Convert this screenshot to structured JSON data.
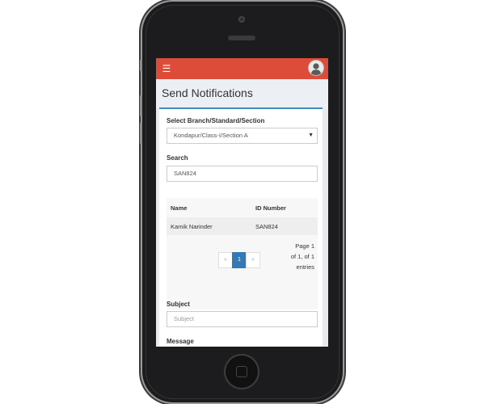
{
  "app": {
    "page_title": "Send Notifications"
  },
  "form": {
    "branch_label": "Select Branch/Standard/Section",
    "branch_value": "Kondapur/Class-I/Section A",
    "search_label": "Search",
    "search_value": "SAN824",
    "subject_label": "Subject",
    "subject_placeholder": "Subject",
    "message_label": "Message"
  },
  "table": {
    "headers": [
      "Name",
      "ID Number"
    ],
    "rows": [
      [
        "Kamik Narinder",
        "SAN824"
      ]
    ]
  },
  "pagination": {
    "prev": "«",
    "current": "1",
    "next": "»",
    "info_line1": "Page 1",
    "info_line2": "of 1, of 1",
    "info_line3": "entries"
  },
  "icons": {
    "menu": "hamburger-icon",
    "avatar": "user-avatar",
    "dropdown": "caret-down-icon"
  },
  "colors": {
    "topbar": "#dd4b39",
    "accent": "#3c8dbc",
    "page_active": "#337ab7"
  }
}
